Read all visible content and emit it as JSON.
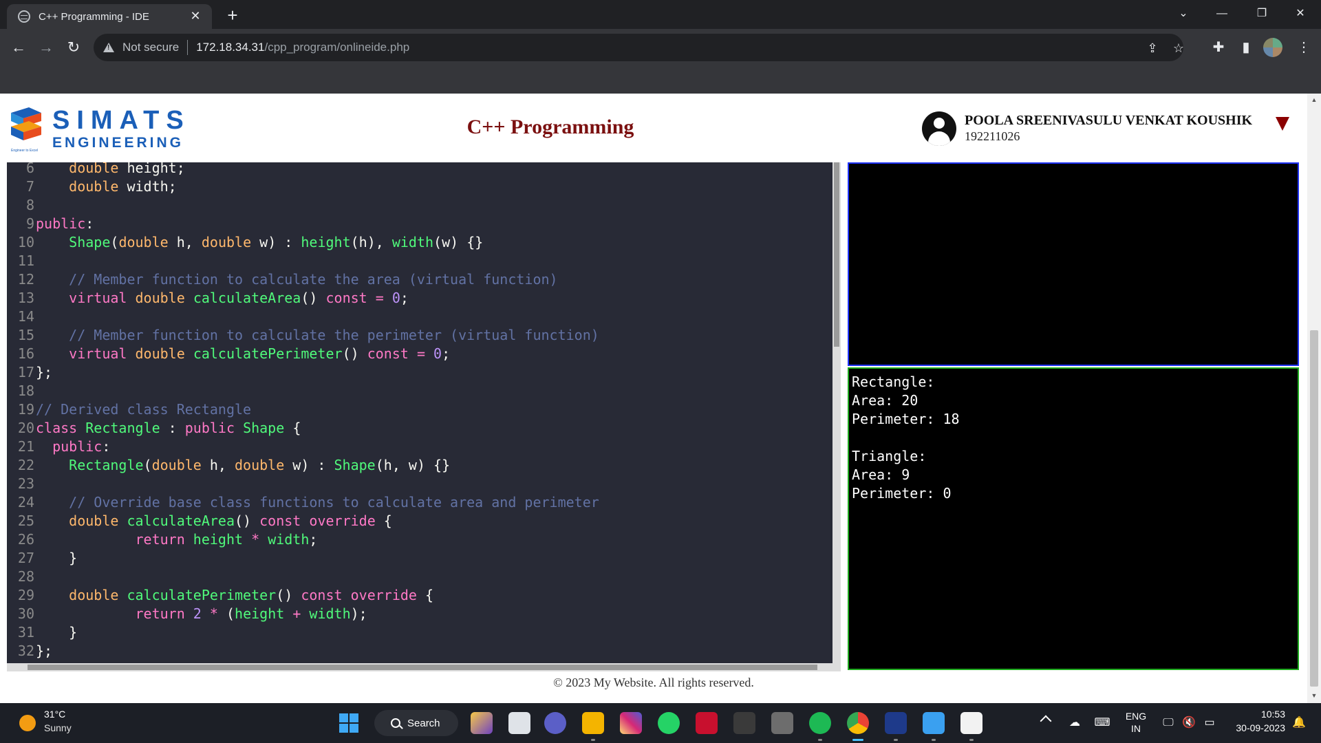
{
  "browser": {
    "tab_title": "C++ Programming - IDE",
    "tab_close": "✕",
    "new_tab": "+",
    "win_chevron": "⌄",
    "win_minimize": "—",
    "win_restore": "❐",
    "win_close": "✕",
    "security_label": "Not secure",
    "url_host": "172.18.34.31",
    "url_path": "/cpp_program/onlineide.php"
  },
  "header": {
    "logo_word1": "SIMATS",
    "logo_word2": "ENGINEERING",
    "logo_tagline": "Engineer to Excel",
    "page_title": "C++ Programming",
    "user_name": "POOLA SREENIVASULU VENKAT KOUSHIK",
    "user_id": "192211026"
  },
  "editor": {
    "lines": [
      {
        "n": "6",
        "t": [
          [
            "    ",
            ""
          ],
          [
            "double",
            "ty"
          ],
          [
            " height;",
            ""
          ]
        ]
      },
      {
        "n": "7",
        "t": [
          [
            "    ",
            ""
          ],
          [
            "double",
            "ty"
          ],
          [
            " width;",
            ""
          ]
        ]
      },
      {
        "n": "8",
        "t": []
      },
      {
        "n": "9",
        "t": [
          [
            "public",
            "kw"
          ],
          [
            ":",
            ""
          ]
        ]
      },
      {
        "n": "10",
        "t": [
          [
            "    ",
            ""
          ],
          [
            "Shape",
            "fn"
          ],
          [
            "(",
            ""
          ],
          [
            "double",
            "ty"
          ],
          [
            " h, ",
            ""
          ],
          [
            "double",
            "ty"
          ],
          [
            " w) : ",
            ""
          ],
          [
            "height",
            "fn"
          ],
          [
            "(h), ",
            ""
          ],
          [
            "width",
            "fn"
          ],
          [
            "(w) {}",
            ""
          ]
        ]
      },
      {
        "n": "11",
        "t": []
      },
      {
        "n": "12",
        "t": [
          [
            "    ",
            ""
          ],
          [
            "// Member function to calculate the area (virtual function)",
            "cm"
          ]
        ]
      },
      {
        "n": "13",
        "t": [
          [
            "    ",
            ""
          ],
          [
            "virtual",
            "kw"
          ],
          [
            " ",
            ""
          ],
          [
            "double",
            "ty"
          ],
          [
            " ",
            ""
          ],
          [
            "calculateArea",
            "fn"
          ],
          [
            "() ",
            ""
          ],
          [
            "const",
            "kw"
          ],
          [
            " ",
            ""
          ],
          [
            "=",
            "kw"
          ],
          [
            " ",
            ""
          ],
          [
            "0",
            "num"
          ],
          [
            ";",
            ""
          ]
        ]
      },
      {
        "n": "14",
        "t": []
      },
      {
        "n": "15",
        "t": [
          [
            "    ",
            ""
          ],
          [
            "// Member function to calculate the perimeter (virtual function)",
            "cm"
          ]
        ]
      },
      {
        "n": "16",
        "t": [
          [
            "    ",
            ""
          ],
          [
            "virtual",
            "kw"
          ],
          [
            " ",
            ""
          ],
          [
            "double",
            "ty"
          ],
          [
            " ",
            ""
          ],
          [
            "calculatePerimeter",
            "fn"
          ],
          [
            "() ",
            ""
          ],
          [
            "const",
            "kw"
          ],
          [
            " ",
            ""
          ],
          [
            "=",
            "kw"
          ],
          [
            " ",
            ""
          ],
          [
            "0",
            "num"
          ],
          [
            ";",
            ""
          ]
        ]
      },
      {
        "n": "17",
        "t": [
          [
            "};",
            ""
          ]
        ]
      },
      {
        "n": "18",
        "t": []
      },
      {
        "n": "19",
        "t": [
          [
            "// Derived class Rectangle",
            "cm"
          ]
        ]
      },
      {
        "n": "20",
        "t": [
          [
            "class",
            "kw"
          ],
          [
            " ",
            ""
          ],
          [
            "Rectangle",
            "fn"
          ],
          [
            " : ",
            ""
          ],
          [
            "public",
            "kw"
          ],
          [
            " ",
            ""
          ],
          [
            "Shape",
            "fn"
          ],
          [
            " {",
            ""
          ]
        ]
      },
      {
        "n": "21",
        "t": [
          [
            "  ",
            ""
          ],
          [
            "public",
            "kw"
          ],
          [
            ":",
            ""
          ]
        ]
      },
      {
        "n": "22",
        "t": [
          [
            "    ",
            ""
          ],
          [
            "Rectangle",
            "fn"
          ],
          [
            "(",
            ""
          ],
          [
            "double",
            "ty"
          ],
          [
            " h, ",
            ""
          ],
          [
            "double",
            "ty"
          ],
          [
            " w) : ",
            ""
          ],
          [
            "Shape",
            "fn"
          ],
          [
            "(h, w) {}",
            ""
          ]
        ]
      },
      {
        "n": "23",
        "t": []
      },
      {
        "n": "24",
        "t": [
          [
            "    ",
            ""
          ],
          [
            "// Override base class functions to calculate area and perimeter",
            "cm"
          ]
        ]
      },
      {
        "n": "25",
        "t": [
          [
            "    ",
            ""
          ],
          [
            "double",
            "ty"
          ],
          [
            " ",
            ""
          ],
          [
            "calculateArea",
            "fn"
          ],
          [
            "() ",
            ""
          ],
          [
            "const",
            "kw"
          ],
          [
            " ",
            ""
          ],
          [
            "override",
            "kw"
          ],
          [
            " {",
            ""
          ]
        ]
      },
      {
        "n": "26",
        "t": [
          [
            "            ",
            ""
          ],
          [
            "return",
            "kw"
          ],
          [
            " ",
            ""
          ],
          [
            "height",
            "fn"
          ],
          [
            " ",
            ""
          ],
          [
            "*",
            "kw"
          ],
          [
            " ",
            ""
          ],
          [
            "width",
            "fn"
          ],
          [
            ";",
            ""
          ]
        ]
      },
      {
        "n": "27",
        "t": [
          [
            "    }",
            ""
          ]
        ]
      },
      {
        "n": "28",
        "t": []
      },
      {
        "n": "29",
        "t": [
          [
            "    ",
            ""
          ],
          [
            "double",
            "ty"
          ],
          [
            " ",
            ""
          ],
          [
            "calculatePerimeter",
            "fn"
          ],
          [
            "() ",
            ""
          ],
          [
            "const",
            "kw"
          ],
          [
            " ",
            ""
          ],
          [
            "override",
            "kw"
          ],
          [
            " {",
            ""
          ]
        ]
      },
      {
        "n": "30",
        "t": [
          [
            "            ",
            ""
          ],
          [
            "return",
            "kw"
          ],
          [
            " ",
            ""
          ],
          [
            "2",
            "num"
          ],
          [
            " ",
            ""
          ],
          [
            "*",
            "kw"
          ],
          [
            " (",
            ""
          ],
          [
            "height",
            "fn"
          ],
          [
            " ",
            ""
          ],
          [
            "+",
            "kw"
          ],
          [
            " ",
            ""
          ],
          [
            "width",
            "fn"
          ],
          [
            ");",
            ""
          ]
        ]
      },
      {
        "n": "31",
        "t": [
          [
            "    }",
            ""
          ]
        ]
      },
      {
        "n": "32",
        "t": [
          [
            "};",
            ""
          ]
        ]
      }
    ]
  },
  "output": {
    "lines": [
      "Rectangle:",
      "Area: 20",
      "Perimeter: 18",
      "",
      "Triangle:",
      "Area: 9",
      "Perimeter: 0"
    ]
  },
  "footer": {
    "text": "© 2023 My Website. All rights reserved."
  },
  "taskbar": {
    "temperature": "31°C",
    "condition": "Sunny",
    "search_label": "Search",
    "lang_line1": "ENG",
    "lang_line2": "IN",
    "time": "10:53",
    "date": "30-09-2023"
  },
  "colors": {
    "editor_bg": "#282a36",
    "keyword": "#ff79c6",
    "type": "#ffb86c",
    "function": "#50fa7b",
    "comment": "#6272a4",
    "number": "#bd93f9",
    "title_red": "#7b1010",
    "brand_blue": "#1b5fb8",
    "input_border": "#2033ff",
    "output_border": "#1eaa1e"
  }
}
